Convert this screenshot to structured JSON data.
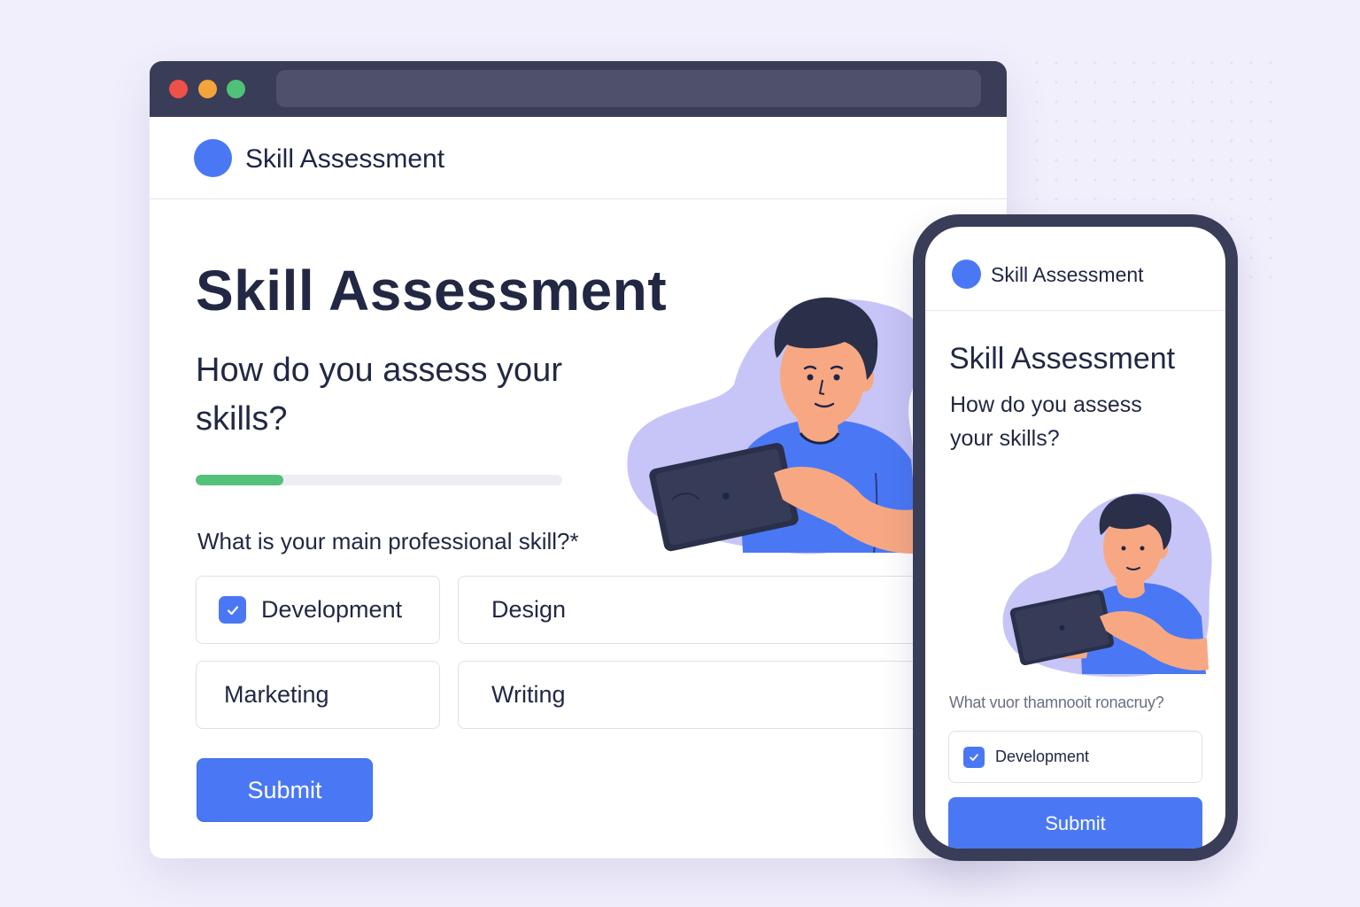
{
  "desktop": {
    "app_name": "Skill Assessment",
    "page_title": "Skill Assessment",
    "page_subtitle": "How do you assess your skills?",
    "progress_fraction": 0.24,
    "question": "What is your main professional skill?*",
    "options": [
      {
        "label": "Development",
        "checked": true
      },
      {
        "label": "Design",
        "checked": false
      },
      {
        "label": "Marketing",
        "checked": false
      },
      {
        "label": "Writing",
        "checked": false
      }
    ],
    "submit_label": "Submit"
  },
  "mobile": {
    "app_name": "Skill Assessment",
    "page_title": "Skill Assessment",
    "page_subtitle": "How do you assess your skills?",
    "question": "What vuor thamnooit ronacruy?",
    "option": {
      "label": "Development",
      "checked": true
    },
    "submit_label": "Submit"
  },
  "colors": {
    "accent": "#4a78f5",
    "progress": "#53c17a",
    "text": "#222844",
    "background": "#f1effc",
    "chrome": "#3a3d57",
    "blob": "#c7c5f7",
    "skin": "#f7a882",
    "hair": "#2a2f4a"
  },
  "icons": [
    "checkmark-icon",
    "traffic-light-close",
    "traffic-light-minimize",
    "traffic-light-maximize"
  ]
}
